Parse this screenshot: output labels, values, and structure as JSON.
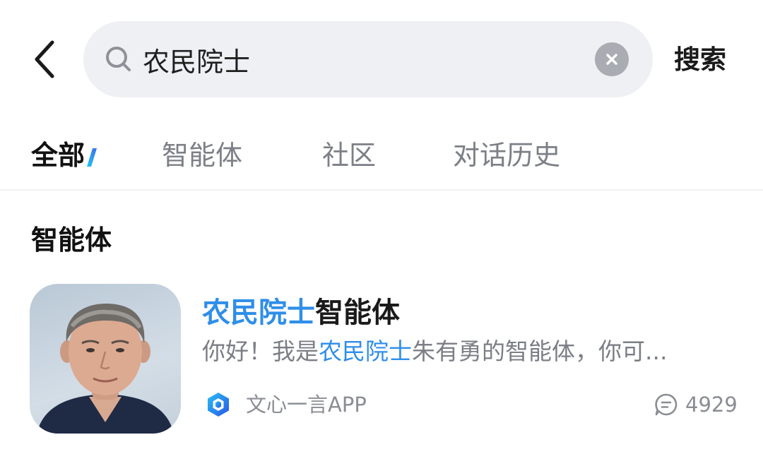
{
  "header": {
    "search_query": "农民院士",
    "search_button_label": "搜索",
    "back_icon": "chevron-left-icon",
    "search_icon": "search-icon",
    "clear_icon": "clear-icon"
  },
  "tabs": [
    {
      "label": "全部",
      "active": true
    },
    {
      "label": "智能体",
      "active": false
    },
    {
      "label": "社区",
      "active": false
    },
    {
      "label": "对话历史",
      "active": false
    }
  ],
  "section": {
    "title": "智能体"
  },
  "results": [
    {
      "title_highlight": "农民院士",
      "title_rest": "智能体",
      "description_prefix": "你好！我是",
      "description_highlight": "农民院士",
      "description_suffix": "朱有勇的智能体，你可...",
      "source_name": "文心一言APP",
      "comment_count": "4929",
      "avatar_icon": "person-portrait",
      "source_icon": "wenxin-logo-icon",
      "comment_icon": "comment-icon"
    }
  ],
  "colors": {
    "accent": "#2f8ee8",
    "search_bg": "#eef0f3",
    "muted_text": "#7b7e85"
  }
}
